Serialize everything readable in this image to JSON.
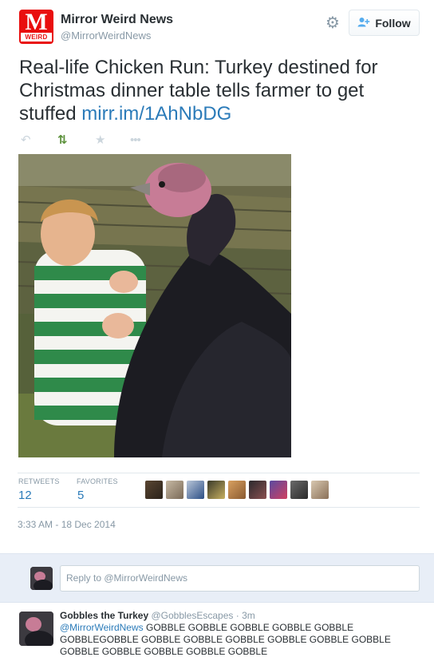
{
  "account": {
    "logo_letter": "M",
    "logo_sub": "WEIRD",
    "name": "Mirror Weird News",
    "handle": "@MirrorWeirdNews",
    "brand_color": "#e90e0e"
  },
  "header_actions": {
    "settings_icon": "gear-icon",
    "follow_icon": "person-add-icon",
    "follow_label": "Follow"
  },
  "tweet": {
    "text": "Real-life Chicken Run: Turkey destined for Christmas dinner table tells farmer to get stuffed",
    "link": "mirr.im/1AhNbDG",
    "link_color": "#2b7bb9"
  },
  "actions": {
    "reply_icon": "reply-icon",
    "retweet_icon": "retweet-icon",
    "favorite_icon": "star-icon",
    "more_icon": "more-icon",
    "retweet_color": "#5c913b"
  },
  "stats": {
    "retweets_label": "RETWEETS",
    "retweets_count": "12",
    "favorites_label": "FAVORITES",
    "favorites_count": "5",
    "avatar_count": 9
  },
  "timestamp": "3:33 AM - 18 Dec 2014",
  "reply": {
    "placeholder": "Reply to @MirrorWeirdNews"
  },
  "reply_tweet": {
    "name": "Gobbles the Turkey",
    "handle": "@GobblesEscapes",
    "separator": "·",
    "time": "3m",
    "mention": "@MirrorWeirdNews",
    "body": "GOBBLE GOBBLE GOBBLE GOBBLE GOBBLE GOBBLEGOBBLE GOBBLE GOBBLE GOBBLE GOBBLE GOBBLE GOBBLE GOBBLE GOBBLE GOBBLE GOBBLE GOBBLE"
  }
}
